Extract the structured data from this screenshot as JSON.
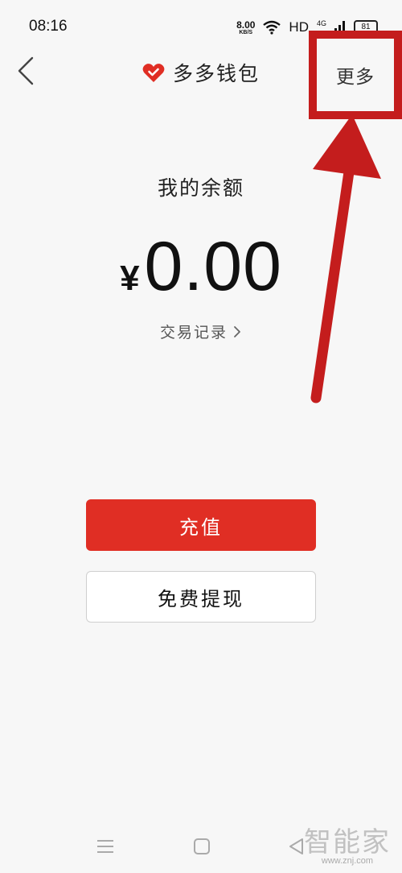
{
  "status_bar": {
    "time": "08:16",
    "net_speed_value": "8.00",
    "net_speed_unit": "KB/S",
    "signal_hd": "HD",
    "signal_4g": "4G",
    "battery": "81"
  },
  "header": {
    "title": "多多钱包",
    "more_label": "更多"
  },
  "balance": {
    "label": "我的余额",
    "currency": "¥",
    "amount": "0.00",
    "transactions_link": "交易记录"
  },
  "actions": {
    "recharge_label": "充值",
    "withdraw_label": "免费提现"
  },
  "watermark": {
    "text": "智能家",
    "url": "www.znj.com"
  },
  "colors": {
    "accent": "#e02e24",
    "annotation": "#c41d1d",
    "background": "#f7f7f7"
  },
  "icons": {
    "back": "chevron-left-icon",
    "logo": "heart-check-icon",
    "link_arrow": "chevron-right-icon",
    "wifi": "wifi-icon",
    "signal": "signal-bars-icon",
    "battery": "battery-icon",
    "nav_menu": "menu-icon",
    "nav_home": "home-square-icon",
    "nav_back": "triangle-back-icon"
  }
}
